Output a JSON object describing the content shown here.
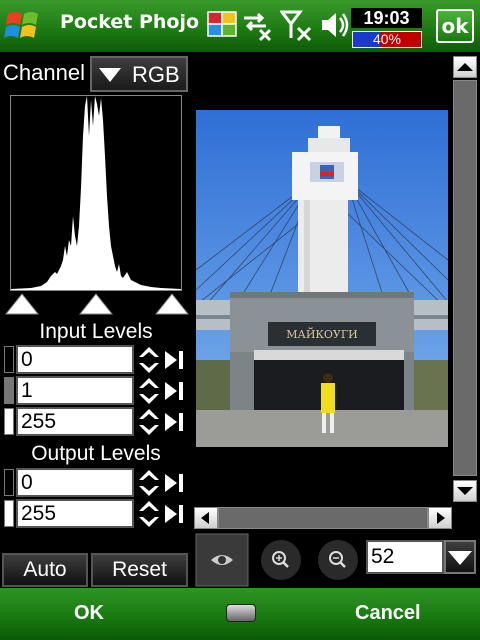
{
  "titlebar": {
    "app_title": "Pocket Phojo",
    "clock": "19:03",
    "battery_percent": "40%",
    "battery_level": 0.4,
    "ok_label": "ok"
  },
  "channel": {
    "label": "Channel",
    "selected": "RGB"
  },
  "input_levels": {
    "title": "Input Levels",
    "black": "0",
    "gamma": "1",
    "white": "255"
  },
  "output_levels": {
    "title": "Output Levels",
    "black": "0",
    "white": "255"
  },
  "buttons": {
    "auto": "Auto",
    "reset": "Reset"
  },
  "preview_photo_sign": "МАЙКОУГИ",
  "zoom": {
    "value": "52"
  },
  "softkeys": {
    "left": "OK",
    "right": "Cancel"
  },
  "colors": {
    "titlebar_green": "#1e7c14",
    "battery_red": "#c00000",
    "battery_blue": "#1a3acc"
  }
}
